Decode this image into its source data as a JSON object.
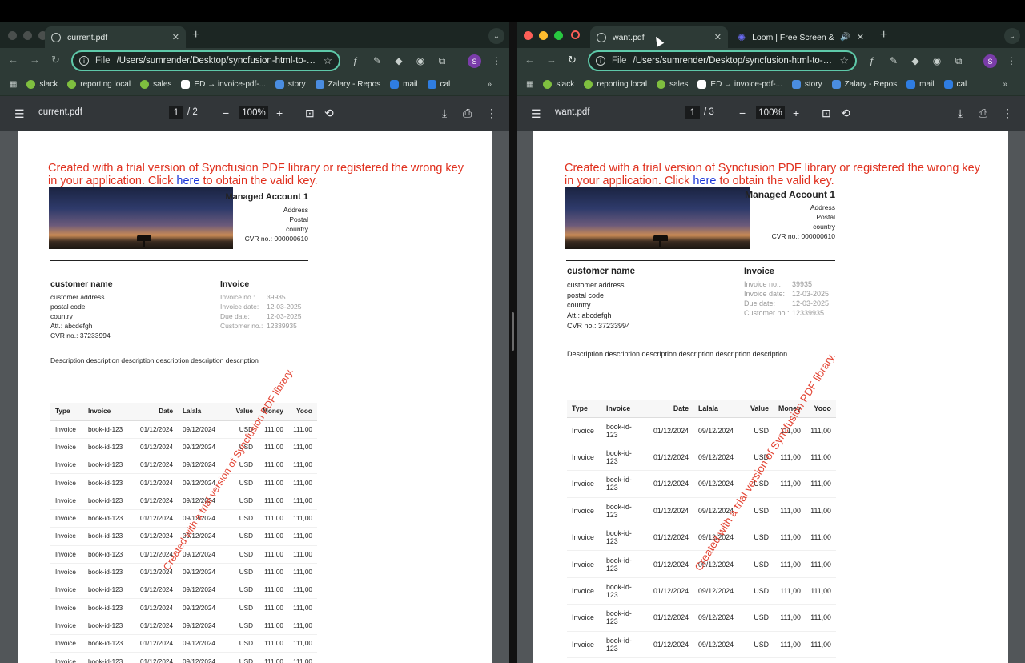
{
  "left": {
    "tab_title": "current.pdf",
    "url_scheme": "File",
    "url": "/Users/sumrender/Desktop/syncfusion-html-to-p...",
    "pdf_title": "current.pdf",
    "page_current": "1",
    "page_total": "2",
    "zoom": "100%"
  },
  "right": {
    "tab_title": "want.pdf",
    "tab2_title": "Loom | Free Screen & Vide",
    "url_scheme": "File",
    "url": "/Users/sumrender/Desktop/syncfusion-html-to-p...",
    "pdf_title": "want.pdf",
    "page_current": "1",
    "page_total": "3",
    "zoom": "100%"
  },
  "bookmarks": [
    {
      "label": "slack",
      "color": "#7fbf3f"
    },
    {
      "label": "reporting local",
      "color": "#7fbf3f"
    },
    {
      "label": "sales",
      "color": "#7fbf3f"
    },
    {
      "label": "ED → invoice-pdf-...",
      "color": "#ffffff"
    },
    {
      "label": "story",
      "color": "#4a8de0"
    },
    {
      "label": "Zalary - Repos",
      "color": "#4a8de0"
    },
    {
      "label": "mail",
      "color": "#2f7de1"
    },
    {
      "label": "cal",
      "color": "#2f7de1"
    }
  ],
  "avatar_letter": "S",
  "doc": {
    "watermark_line1": "Created with a trial version of Syncfusion PDF library or registered the wrong key",
    "watermark_line2_pre": "in your application. Click ",
    "watermark_link": "here",
    "watermark_line2_post": " to obtain the valid key.",
    "diagonal_watermark": "Created with a trial version of Syncfusion PDF library.",
    "account_name": "Managed Account 1",
    "account_lines": [
      "Address",
      "Postal",
      "country",
      "CVR no.: 000000610"
    ],
    "customer_name": "customer name",
    "customer_lines": [
      "customer address",
      "postal code",
      "country",
      "Att.: abcdefgh",
      "CVR no.: 37233994"
    ],
    "invoice_heading": "Invoice",
    "invoice_rows": [
      {
        "label": "Invoice no.:",
        "value": "39935"
      },
      {
        "label": "Invoice date:",
        "value": "12-03-2025"
      },
      {
        "label": "Due date:",
        "value": "12-03-2025"
      },
      {
        "label": "Customer no.:",
        "value": "12339935"
      }
    ],
    "description": "Description description description description description description",
    "table_headers": [
      "Type",
      "Invoice",
      "Date",
      "Lalala",
      "Value",
      "Money",
      "Yooo"
    ],
    "row": {
      "type": "Invoice",
      "invoice": "book-id-123",
      "invoice_a": "book-id-",
      "invoice_b": "123",
      "date": "01/12/2024",
      "lalala": "09/12/2024",
      "value": "USD",
      "money": "111,00",
      "yooo": "111,00"
    }
  }
}
